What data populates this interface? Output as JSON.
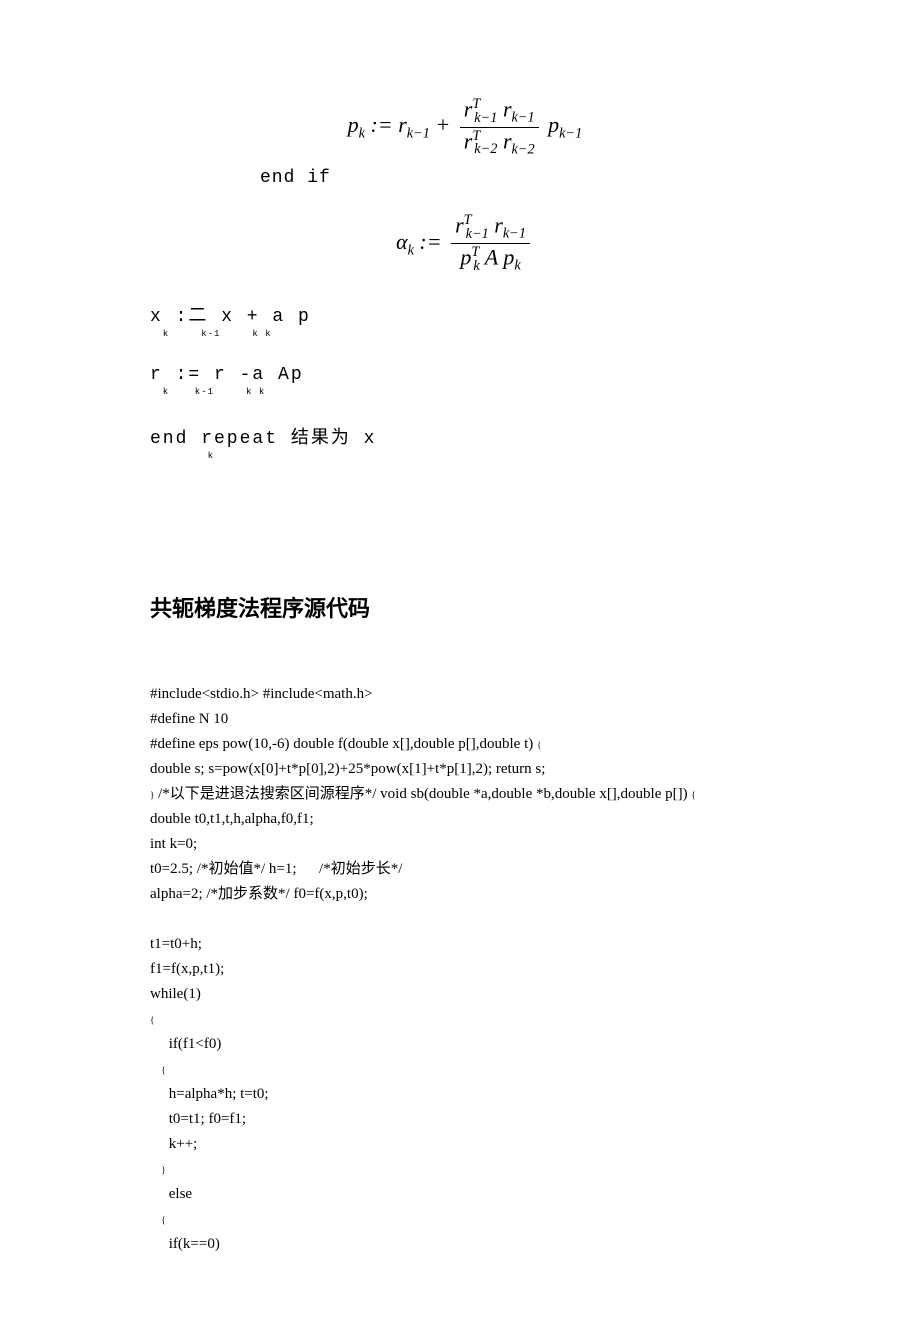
{
  "formula1_text": "p_k := r_{k-1} + (r_{k-1}^T r_{k-1}) / (r_{k-2}^T r_{k-2}) · p_{k-1}",
  "endif": "end if",
  "formula2_text": "alpha_k := (r_{k-1}^T r_{k-1}) / (p_k^T A p_k)",
  "algo": {
    "line1": "x :二 x + a p",
    "line1_sub": "  k     k-1     k k",
    "line2": "r := r -a Ap",
    "line2_sub": "  k    k-1     k k",
    "line3": "end repeat 结果为 x",
    "line3_sub": "         k"
  },
  "section_title": "共轭梯度法程序源代码",
  "code_lines": [
    "#include<stdio.h> #include<math.h>",
    "#define N 10",
    "#define eps pow(10,-6) double f(double x[],double p[],double t) {",
    "double s; s=pow(x[0]+t*p[0],2)+25*pow(x[1]+t*p[1],2); return s;",
    "} /*以下是进退法搜索区间源程序*/ void sb(double *a,double *b,double x[],double p[]) {",
    "double t0,t1,t,h,alpha,f0,f1;",
    "int k=0;",
    "t0=2.5; /*初始值*/ h=1;      /*初始步长*/",
    "alpha=2; /*加步系数*/ f0=f(x,p,t0);",
    "",
    "t1=t0+h;",
    "f1=f(x,p,t1);",
    "while(1)",
    "{",
    "     if(f1<f0)",
    "     {",
    "     h=alpha*h; t=t0;",
    "     t0=t1; f0=f1;",
    "     k++;",
    "     }",
    "     else",
    "     {",
    "     if(k==0)"
  ]
}
